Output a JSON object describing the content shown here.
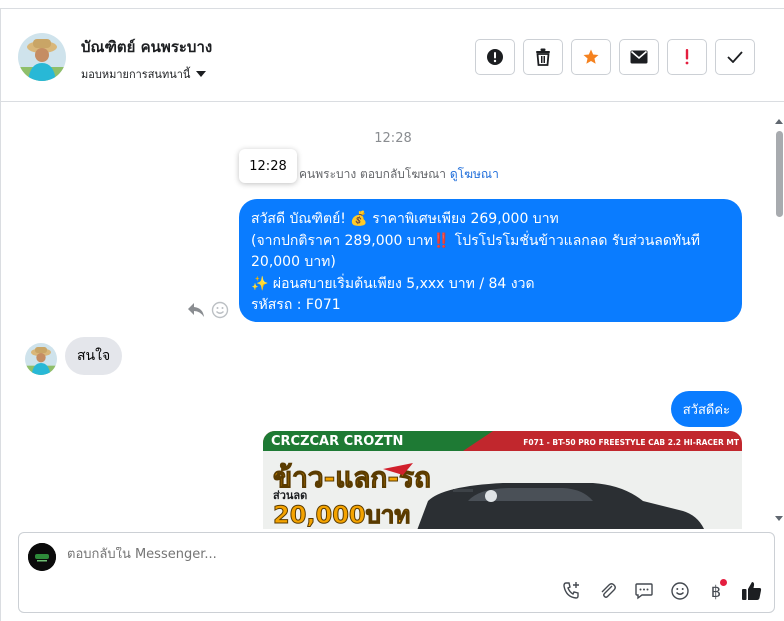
{
  "header": {
    "contact_name": "บัณฑิตย์ คนพระบาง",
    "assign_label": "มอบหมายการสนทนานี้"
  },
  "actions": [
    "spam-report",
    "delete",
    "star",
    "mark-unread",
    "important",
    "done"
  ],
  "thread": {
    "timestamp": "12:28",
    "tooltip_time": "12:28",
    "reply_info": "คนพระบาง ตอบกลับโฆษณา",
    "reply_link": "ดูโฆษณา",
    "outgoing_message": {
      "line1": "สวัสดี บัณฑิตย์! 💰 ราคาพิเศษเพียง 269,000 บาท",
      "line2": "(จากปกติราคา 289,000 บาท‼️ โปรโปรโมชั่นข้าวแลกลด รับส่วนลดทันที",
      "line3": "20,000 บาท)",
      "line4": "✨ ผ่อนสบายเริ่มต้นเพียง 5,xxx บาท / 84 งวด",
      "line5": " รหัสรถ : F071"
    },
    "incoming_message": "สนใจ",
    "outgoing_greeting": "สวัสดีค่ะ",
    "ad_image": {
      "brand_text": "CRCZCAR CROZTN",
      "model_text": "F071 - BT-50 PRO FREESTYLE CAB 2.2 HI-RACER MT",
      "headline": "ข้าว-แลก-รถ",
      "discount_label": "ส่วนลด",
      "discount_amount": "20,000บาท"
    }
  },
  "composer": {
    "placeholder": "ตอบกลับใน Messenger..."
  },
  "colors": {
    "brand_blue": "#0a7cff",
    "incoming_bubble": "#e4e6eb",
    "star": "#f5821f",
    "important": "#e41e3f"
  }
}
